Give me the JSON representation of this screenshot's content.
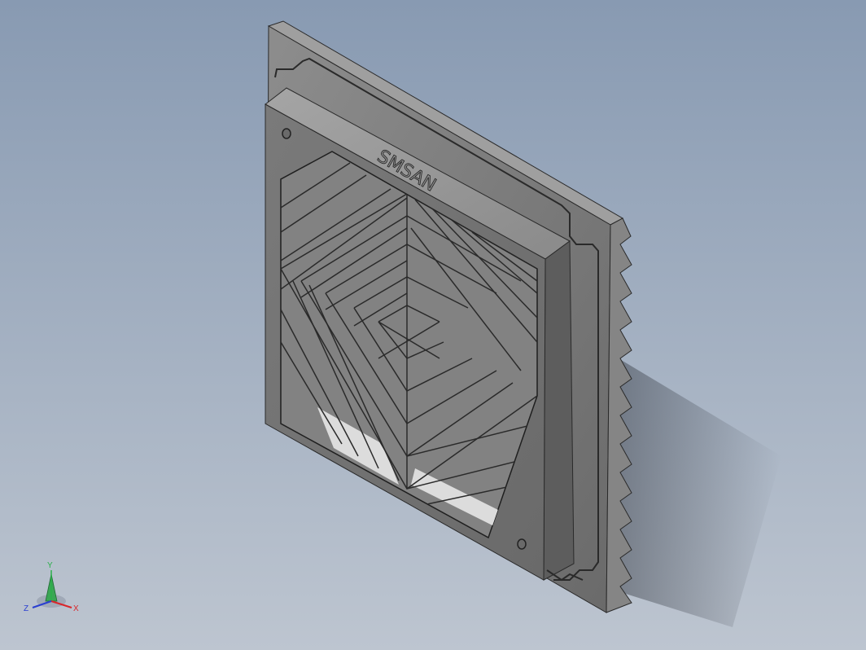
{
  "model": {
    "embossed_text": "SMSAN",
    "name": "fan-filter-grille"
  },
  "triad": {
    "x_label": "X",
    "y_label": "Y",
    "z_label": "Z"
  },
  "colors": {
    "background_top": "#8a9bb2",
    "background_bottom": "#bcc4cf",
    "part_dark": "#5f5f5f",
    "part_mid": "#7c7c7c",
    "part_light": "#9c9c9c",
    "part_face": "#717171",
    "edge": "#2a2a2a",
    "axis_x": "#d9262b",
    "axis_y": "#2ab04a",
    "axis_z": "#2a3fd0"
  }
}
